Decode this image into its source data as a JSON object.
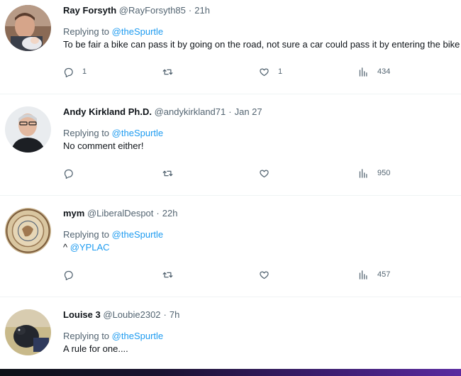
{
  "tweets": [
    {
      "name": "Ray Forsyth",
      "handle": "@RayForsyth85",
      "time": "21h",
      "replying_prefix": "Replying to",
      "replying_to": "@theSpurtle",
      "text": "To be fair a bike can pass it by going on the road, not sure a car could pass it by entering the bike lane 👀",
      "replies": "1",
      "retweets": "",
      "likes": "1",
      "views": "434"
    },
    {
      "name": "Andy Kirkland Ph.D.",
      "handle": "@andykirkland71",
      "time": "Jan 27",
      "replying_prefix": "Replying to",
      "replying_to": "@theSpurtle",
      "text": "No comment either!",
      "replies": "",
      "retweets": "",
      "likes": "",
      "views": "950"
    },
    {
      "name": "mym",
      "handle": "@LiberalDespot",
      "time": "22h",
      "replying_prefix": "Replying to",
      "replying_to": "@theSpurtle",
      "text_prefix": "^ ",
      "text_mention": "@YPLAC",
      "replies": "",
      "retweets": "",
      "likes": "",
      "views": "457"
    },
    {
      "name": "Louise 3",
      "handle": "@Loubie2302",
      "time": "7h",
      "replying_prefix": "Replying to",
      "replying_to": "@theSpurtle",
      "text": "A rule for one...."
    }
  ],
  "separator": "·",
  "icons": {
    "reply": "reply-icon",
    "retweet": "retweet-icon",
    "like": "heart-icon",
    "views": "views-icon"
  },
  "colors": {
    "link": "#1d9bf0",
    "secondary_text": "#536471",
    "primary_text": "#0f1419"
  }
}
